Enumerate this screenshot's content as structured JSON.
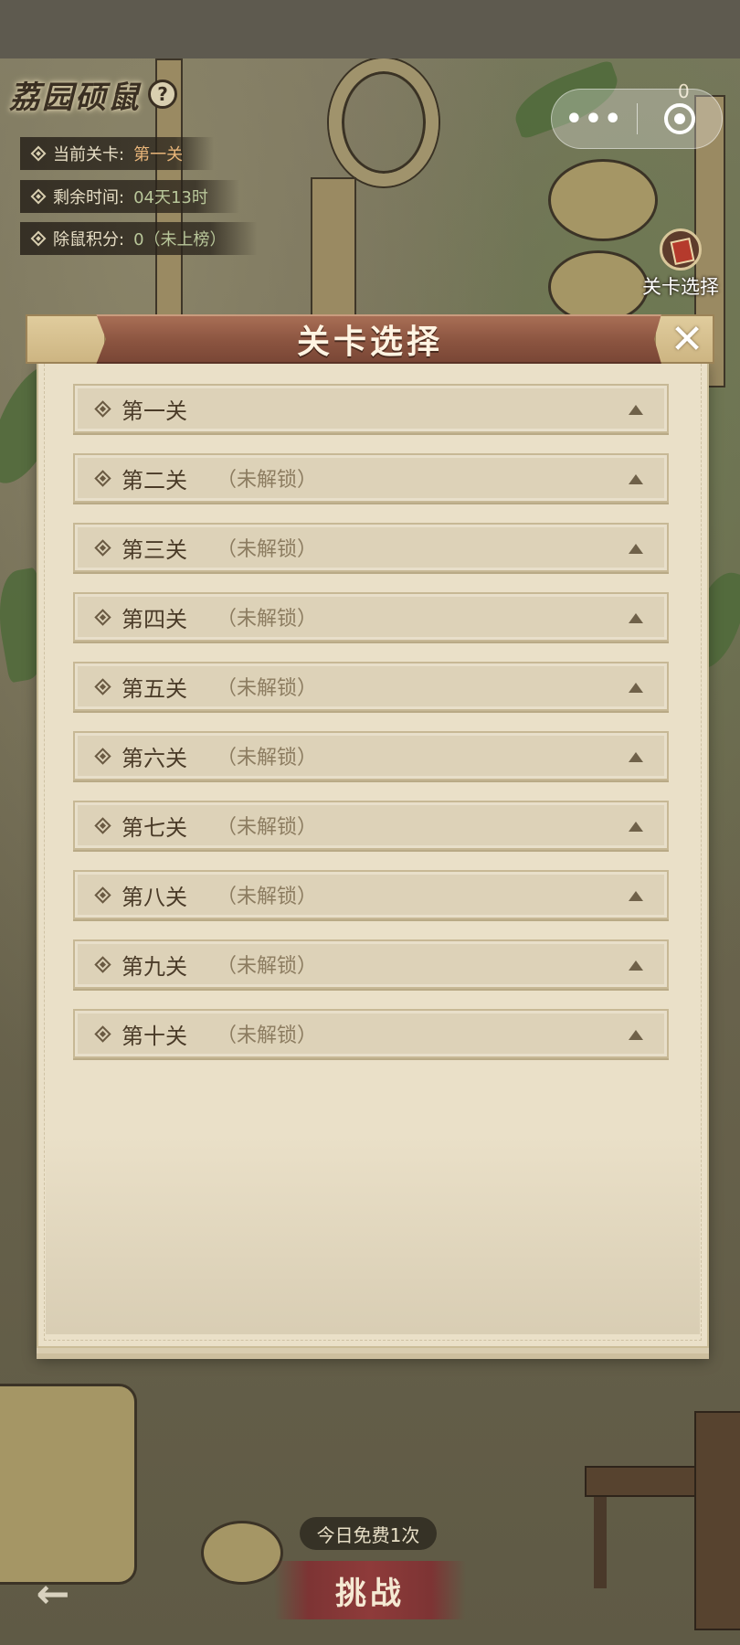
{
  "hud": {
    "title": "荔园硕鼠",
    "help_icon": "?",
    "current_level_label": "当前关卡:",
    "current_level_value": "第一关",
    "remaining_time_label": "剩余时间:",
    "remaining_time_value": "04天13时",
    "score_label": "除鼠积分:",
    "score_value": "0（未上榜）"
  },
  "capsule": {
    "more_icon": "•••",
    "counter": "0"
  },
  "shortcut": {
    "label": "关卡选择",
    "icon": "level-card-icon"
  },
  "panel": {
    "title": "关卡选择",
    "close_icon": "✕",
    "levels": [
      {
        "name": "第一关",
        "status": ""
      },
      {
        "name": "第二关",
        "status": "（未解锁）"
      },
      {
        "name": "第三关",
        "status": "（未解锁）"
      },
      {
        "name": "第四关",
        "status": "（未解锁）"
      },
      {
        "name": "第五关",
        "status": "（未解锁）"
      },
      {
        "name": "第六关",
        "status": "（未解锁）"
      },
      {
        "name": "第七关",
        "status": "（未解锁）"
      },
      {
        "name": "第八关",
        "status": "（未解锁）"
      },
      {
        "name": "第九关",
        "status": "（未解锁）"
      },
      {
        "name": "第十关",
        "status": "（未解锁）"
      }
    ]
  },
  "bottom": {
    "free_badge": "今日免费1次",
    "challenge_label": "挑战",
    "back_icon": "←"
  },
  "colors": {
    "header": "#8b5440",
    "paper": "#eae0c8",
    "row": "#ddd2b8",
    "challenge": "#8e3b3a"
  }
}
